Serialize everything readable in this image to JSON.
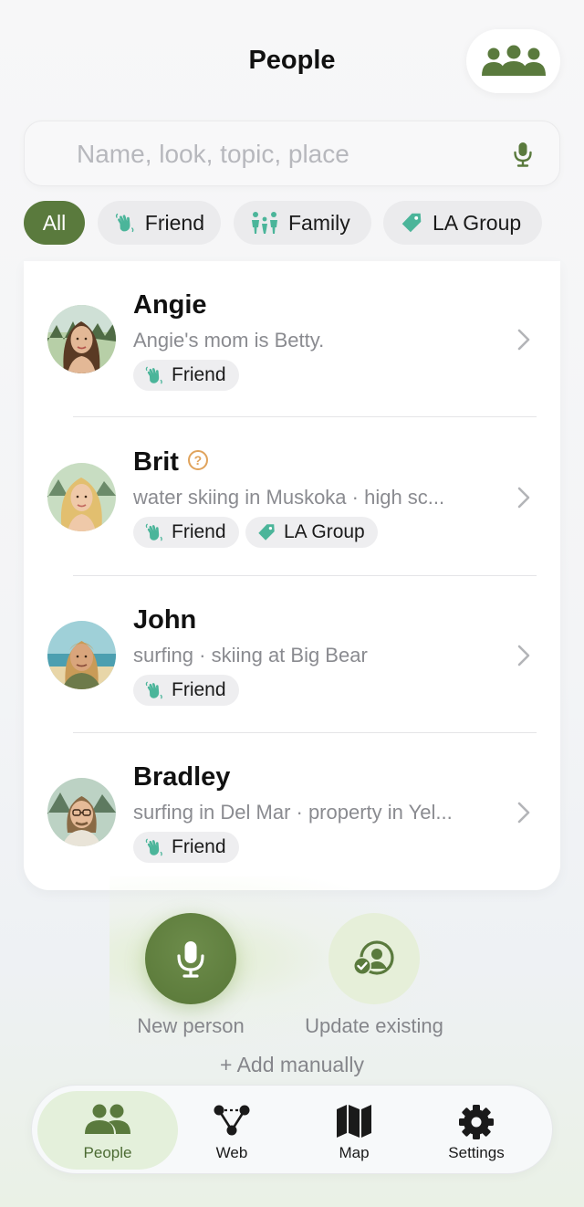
{
  "header": {
    "title": "People",
    "group_icon": "people-group-icon"
  },
  "search": {
    "placeholder": "Name, look, topic, place",
    "value": ""
  },
  "filters": [
    {
      "label": "All",
      "active": true
    },
    {
      "label": "Friend",
      "icon": "waving-hand-icon"
    },
    {
      "label": "Family",
      "icon": "family-icon"
    },
    {
      "label": "LA Group",
      "icon": "tag-icon"
    }
  ],
  "people": [
    {
      "name": "Angie",
      "note": "Angie's mom is Betty.",
      "tags": [
        "Friend"
      ]
    },
    {
      "name": "Brit",
      "note": "water skiing in Muskoka · high sc...",
      "tags": [
        "Friend",
        "LA Group"
      ],
      "unconfirmed": true
    },
    {
      "name": "John",
      "note": "surfing · skiing at Big Bear",
      "tags": [
        "Friend"
      ]
    },
    {
      "name": "Bradley",
      "note": "surfing in Del Mar · property in Yel...",
      "tags": [
        "Friend"
      ]
    }
  ],
  "actions": {
    "new_person": "New person",
    "update_existing": "Update existing",
    "add_manually": "+ Add manually"
  },
  "tabs": [
    {
      "label": "People",
      "active": true
    },
    {
      "label": "Web"
    },
    {
      "label": "Map"
    },
    {
      "label": "Settings"
    }
  ],
  "colors": {
    "accent": "#5a7a3d",
    "accent_light": "#e4f0db",
    "tag_teal": "#4bb59a",
    "help_orange": "#e0a35c"
  }
}
